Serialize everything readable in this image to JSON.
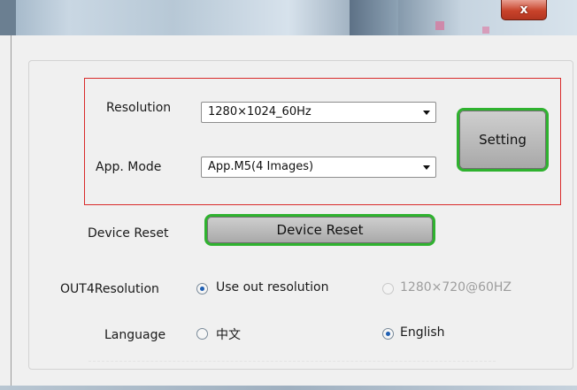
{
  "window": {
    "close_glyph": "x"
  },
  "settings": {
    "resolution": {
      "label": "Resolution",
      "selected": "1280×1024_60Hz"
    },
    "app_mode": {
      "label": "App. Mode",
      "selected": "App.M5(4 Images)"
    },
    "setting_button": "Setting",
    "device_reset": {
      "label": "Device Reset",
      "button": "Device Reset"
    },
    "out4_resolution": {
      "label": "OUT4Resolution",
      "options": [
        {
          "label": "Use out resolution",
          "checked": true,
          "enabled": true
        },
        {
          "label": "1280×720@60HZ",
          "checked": false,
          "enabled": false
        }
      ]
    },
    "language": {
      "label": "Language",
      "options": [
        {
          "label": "中文",
          "checked": false,
          "enabled": true
        },
        {
          "label": "English",
          "checked": true,
          "enabled": true
        }
      ]
    }
  },
  "colors": {
    "highlight_border": "#d92b2b",
    "button_border": "#2fb22f",
    "radio_dot": "#1f5fb3"
  }
}
